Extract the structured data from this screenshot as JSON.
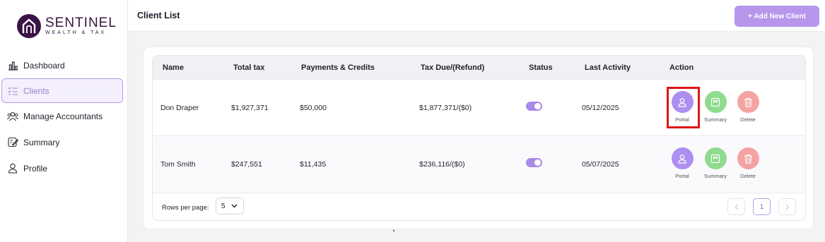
{
  "brand": {
    "name": "SENTINEL",
    "tagline": "WEALTH & TAX",
    "color": "#3b1344"
  },
  "sidebar": {
    "items": [
      {
        "label": "Dashboard",
        "icon": "bar-chart-icon"
      },
      {
        "label": "Clients",
        "icon": "list-check-icon",
        "active": true
      },
      {
        "label": "Manage Accountants",
        "icon": "users-icon"
      },
      {
        "label": "Summary",
        "icon": "edit-document-icon"
      },
      {
        "label": "Profile",
        "icon": "user-icon"
      }
    ]
  },
  "header": {
    "title": "Client List",
    "add_button": "+ Add New Client"
  },
  "table": {
    "columns": [
      "Name",
      "Total tax",
      "Payments & Credits",
      "Tax Due/(Refund)",
      "Status",
      "Last Activity",
      "Action"
    ],
    "rows": [
      {
        "name": "Don Draper",
        "total_tax": "$1,927,371",
        "payments": "$50,000",
        "tax_due": "$1,877,371/($0)",
        "status_on": true,
        "last_activity": "05/12/2025"
      },
      {
        "name": "Tom Smith",
        "total_tax": "$247,551",
        "payments": "$11,435",
        "tax_due": "$236,116/($0)",
        "status_on": true,
        "last_activity": "05/07/2025"
      }
    ],
    "actions": {
      "portal": "Portal",
      "summary": "Summary",
      "delete": "Delete"
    }
  },
  "pagination": {
    "rows_label": "Rows per page:",
    "rows_value": "5",
    "current_page": "1"
  },
  "colors": {
    "accent": "#b697ec",
    "portal": "#ae8ff0",
    "summary": "#8fdb90",
    "delete": "#f4a3a3",
    "highlight": "#e01515"
  }
}
